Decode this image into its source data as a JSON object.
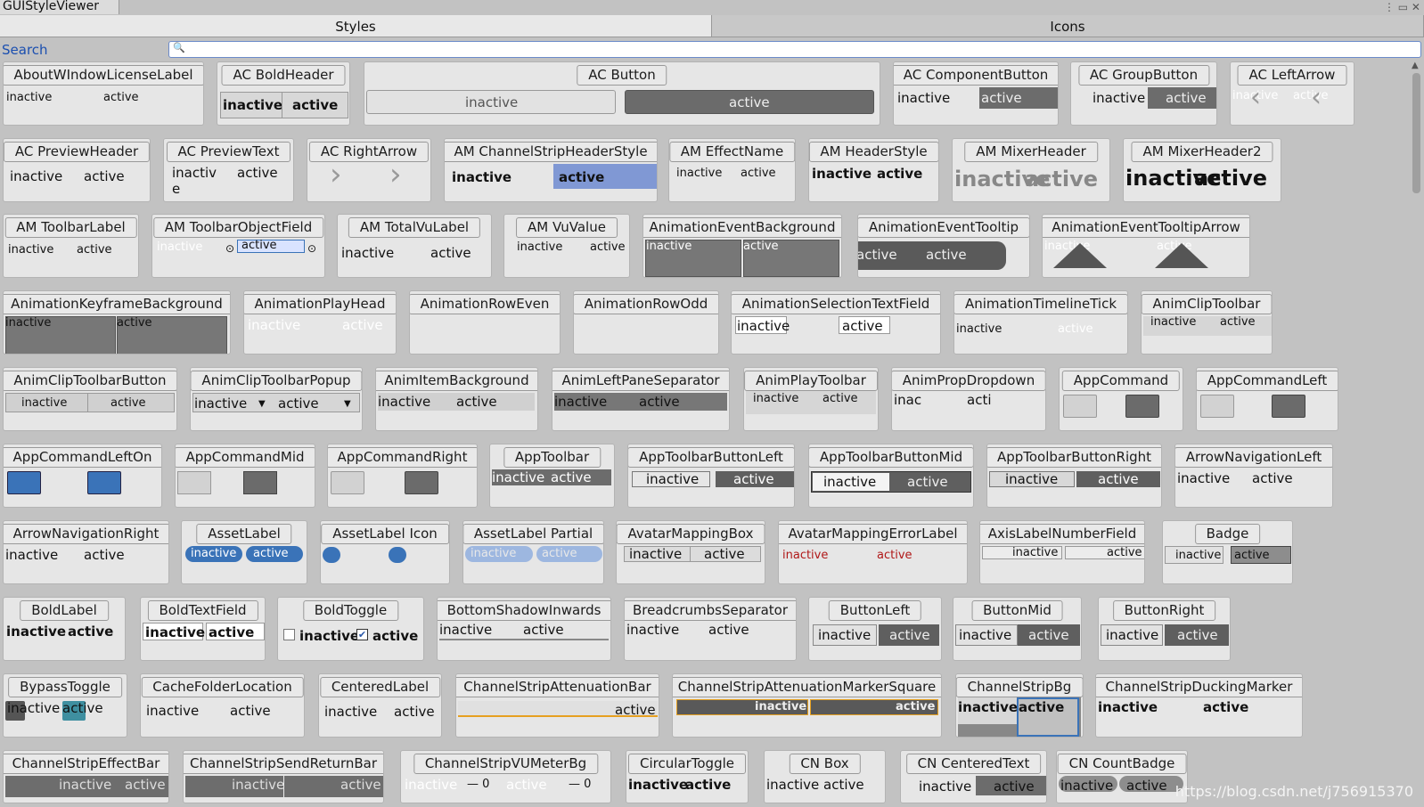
{
  "window": {
    "title": "GUIStyleViewer",
    "controls": "⋮ ▭ ✕"
  },
  "tabs": [
    "Styles",
    "Icons"
  ],
  "search": {
    "label": "Search",
    "icon": "🔍"
  },
  "watermark": "https://blog.csdn.net/j756915370",
  "states": {
    "inactive": "inactive",
    "active": "active",
    "inactiv": "inactiv",
    "e": "e",
    "inac": "inac",
    "acti": "acti"
  },
  "styles": [
    "AboutWIndowLicenseLabel",
    "AC BoldHeader",
    "AC Button",
    "AC ComponentButton",
    "AC GroupButton",
    "AC LeftArrow",
    "AC PreviewHeader",
    "AC PreviewText",
    "AC RightArrow",
    "AM ChannelStripHeaderStyle",
    "AM EffectName",
    "AM HeaderStyle",
    "AM MixerHeader",
    "AM MixerHeader2",
    "AM ToolbarLabel",
    "AM ToolbarObjectField",
    "AM TotalVuLabel",
    "AM VuValue",
    "AnimationEventBackground",
    "AnimationEventTooltip",
    "AnimationEventTooltipArrow",
    "AnimationKeyframeBackground",
    "AnimationPlayHead",
    "AnimationRowEven",
    "AnimationRowOdd",
    "AnimationSelectionTextField",
    "AnimationTimelineTick",
    "AnimClipToolbar",
    "AnimClipToolbarButton",
    "AnimClipToolbarPopup",
    "AnimItemBackground",
    "AnimLeftPaneSeparator",
    "AnimPlayToolbar",
    "AnimPropDropdown",
    "AppCommand",
    "AppCommandLeft",
    "AppCommandLeftOn",
    "AppCommandMid",
    "AppCommandRight",
    "AppToolbar",
    "AppToolbarButtonLeft",
    "AppToolbarButtonMid",
    "AppToolbarButtonRight",
    "ArrowNavigationLeft",
    "ArrowNavigationRight",
    "AssetLabel",
    "AssetLabel Icon",
    "AssetLabel Partial",
    "AvatarMappingBox",
    "AvatarMappingErrorLabel",
    "AxisLabelNumberField",
    "Badge",
    "BoldLabel",
    "BoldTextField",
    "BoldToggle",
    "BottomShadowInwards",
    "BreadcrumbsSeparator",
    "ButtonLeft",
    "ButtonMid",
    "ButtonRight",
    "BypassToggle",
    "CacheFolderLocation",
    "CenteredLabel",
    "ChannelStripAttenuationBar",
    "ChannelStripAttenuationMarkerSquare",
    "ChannelStripBg",
    "ChannelStripDuckingMarker",
    "ChannelStripEffectBar",
    "ChannelStripSendReturnBar",
    "ChannelStripVUMeterBg",
    "CircularToggle",
    "CN Box",
    "CN CenteredText",
    "CN CountBadge"
  ],
  "vu_numbers": {
    "a": "— 0",
    "b": "— 0"
  },
  "colors": {
    "accent_blue": "#3a73b8",
    "selection": "#7f97d6",
    "error_red": "#b01818"
  }
}
